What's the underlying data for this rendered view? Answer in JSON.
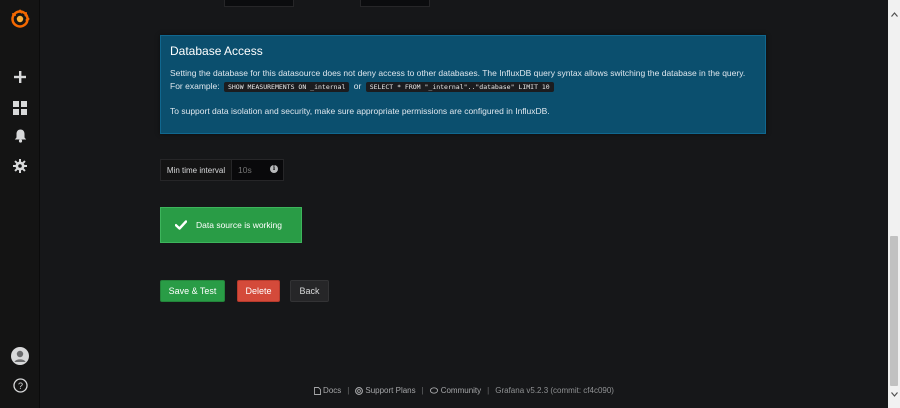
{
  "sidebar": {
    "items": [
      {
        "icon": "grafana-logo-icon"
      },
      {
        "icon": "plus-icon"
      },
      {
        "icon": "dashboards-icon"
      },
      {
        "icon": "bell-icon"
      },
      {
        "icon": "gear-icon"
      },
      {
        "icon": "user-avatar-icon"
      },
      {
        "icon": "help-icon"
      }
    ]
  },
  "info_box": {
    "title": "Database Access",
    "line1": "Setting the database for this datasource does not deny access to other databases. The InfluxDB query syntax allows switching the database in the query.",
    "example_prefix": "For example:",
    "code1": "SHOW MEASUREMENTS ON _internal",
    "or_text": "or",
    "code2": "SELECT * FROM \"_internal\"..\"database\" LIMIT 10",
    "line2": "To support data isolation and security, make sure appropriate permissions are configured in InfluxDB."
  },
  "min_time_interval": {
    "label": "Min time interval",
    "placeholder": "10s",
    "value": ""
  },
  "alert": {
    "message": "Data source is working",
    "color": "#299c46"
  },
  "buttons": {
    "save": "Save & Test",
    "delete": "Delete",
    "back": "Back"
  },
  "footer": {
    "docs": "Docs",
    "support": "Support Plans",
    "community": "Community",
    "version": "Grafana v5.2.3 (commit: cf4c090)",
    "separator": "|"
  },
  "colors": {
    "info_bg": "#0b4f6e",
    "success": "#299c46",
    "danger": "#d44a3a",
    "background": "#161719"
  }
}
